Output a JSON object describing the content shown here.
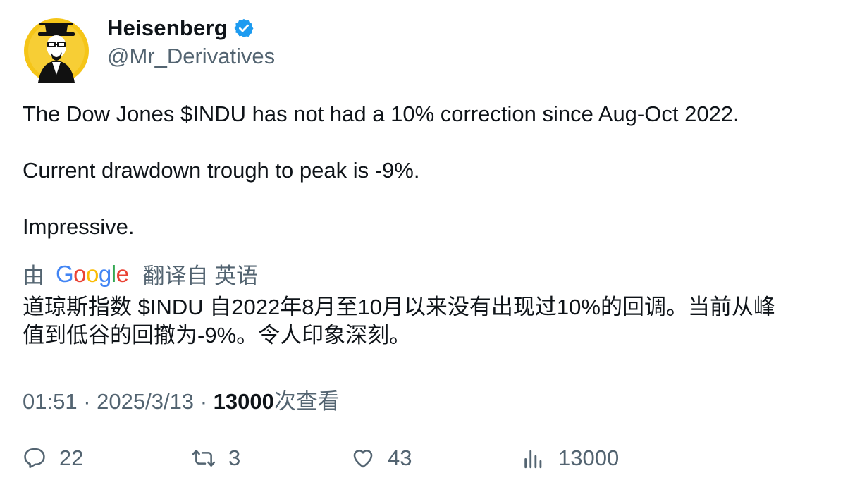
{
  "author": {
    "display_name": "Heisenberg",
    "handle": "@Mr_Derivatives",
    "avatar_icon": "heisenberg-avatar",
    "verified_icon": "verified-badge-icon",
    "verified_color": "#1d9bf0",
    "avatar_bg": "#f5c518"
  },
  "tweet": {
    "paragraphs": [
      "The Dow Jones $INDU has not had a 10% correction since Aug-Oct 2022.",
      "Current drawdown trough to peak is -9%.",
      "Impressive."
    ]
  },
  "translation": {
    "by_label": "由",
    "provider": "Google",
    "from_label": "翻译自 英语",
    "text_line1": "道琼斯指数 $INDU 自2022年8月至10月以来没有出现过10%的回调。当前从峰",
    "text_line2": "值到低谷的回撤为-9%。令人印象深刻。"
  },
  "meta": {
    "time": "01:51",
    "separator": "·",
    "date": "2025/3/13",
    "views_count": "13000",
    "views_label": "次查看"
  },
  "actions": {
    "replies": "22",
    "retweets": "3",
    "likes": "43",
    "views": "13000"
  },
  "colors": {
    "text": "#0f1419",
    "secondary": "#536471"
  }
}
